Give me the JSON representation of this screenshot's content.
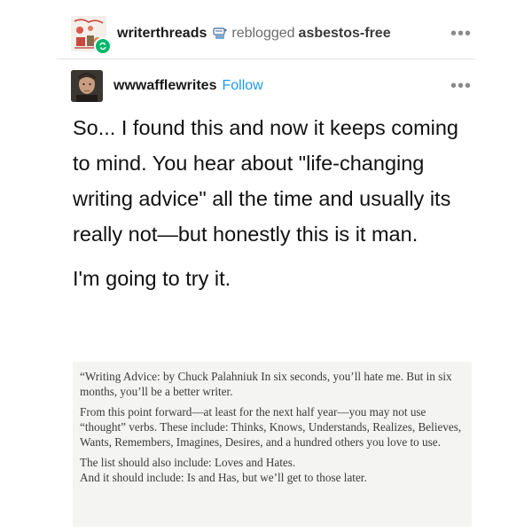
{
  "reblog": {
    "username": "writerthreads",
    "verb": "reblogged",
    "source": "asbestos-free",
    "reblog_icon": "reblog-icon",
    "more_label": "•••"
  },
  "post": {
    "author": "wwwafflewrites",
    "follow_label": "Follow",
    "more_label": "•••",
    "paragraphs": [
      "So... I found this and now it keeps coming to mind. You hear about \"life-changing writing advice\" all the time and usually its really not—but honestly this is it man.",
      "I'm going to try it."
    ]
  },
  "quote_image": {
    "paragraphs": [
      "“Writing Advice: by Chuck Palahniuk In six seconds, you’ll hate me. But in six months, you’ll be a better writer.",
      "From this point forward—at least for the next half year—you may not use “thought” verbs. These include: Thinks, Knows, Understands, Realizes, Believes, Wants, Remembers, Imagines, Desires, and a hundred others you love to use.",
      "The list should also include: Loves and Hates.\nAnd it should include: Is and Has, but we’ll get to those later."
    ]
  },
  "colors": {
    "follow": "#1d9bf0",
    "reblog_badge": "#00b86b",
    "muted_text": "#6b6b6b"
  }
}
